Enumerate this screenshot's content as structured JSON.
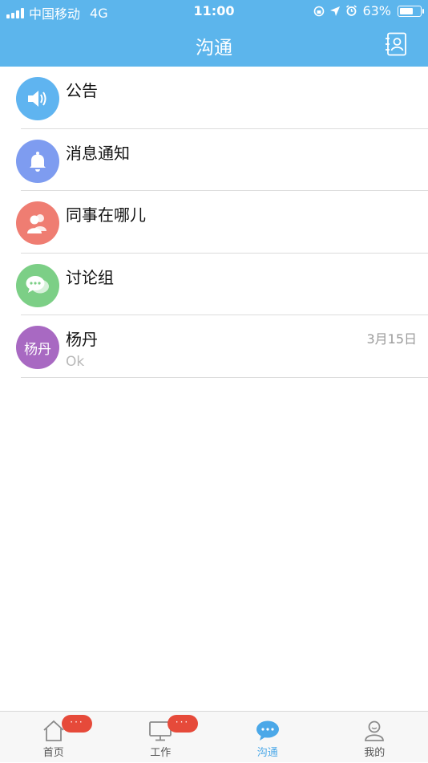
{
  "status": {
    "carrier": "中国移动",
    "network": "4G",
    "time": "11:00",
    "battery": "63%"
  },
  "header": {
    "title": "沟通",
    "contacts_icon": "address-book-icon"
  },
  "list": [
    {
      "name": "公告",
      "icon": "speaker-icon",
      "color": "#5fb4f0"
    },
    {
      "name": "消息通知",
      "icon": "bell-icon",
      "color": "#7e9cf0"
    },
    {
      "name": "同事在哪儿",
      "icon": "people-icon",
      "color": "#ef7d72"
    },
    {
      "name": "讨论组",
      "icon": "chat-bubbles-icon",
      "color": "#7ccf86"
    },
    {
      "name": "杨丹",
      "avatar_text": "杨丹",
      "message": "Ok",
      "date": "3月15日",
      "color": "#a869c2"
    }
  ],
  "tabs": [
    {
      "label": "首页",
      "icon": "home-icon",
      "badge": "···"
    },
    {
      "label": "工作",
      "icon": "monitor-icon",
      "badge": "···"
    },
    {
      "label": "沟通",
      "icon": "chat-icon",
      "active": true
    },
    {
      "label": "我的",
      "icon": "user-icon"
    }
  ],
  "colors": {
    "accent": "#5cb5ec",
    "active_tab": "#4ba8e8",
    "badge": "#e64a3a"
  }
}
